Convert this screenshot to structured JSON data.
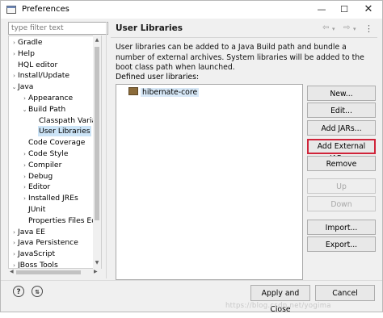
{
  "window": {
    "title": "Preferences"
  },
  "filter": {
    "placeholder": "type filter text"
  },
  "tree": [
    {
      "label": "Gradle",
      "arrow": "›",
      "level": 0
    },
    {
      "label": "Help",
      "arrow": "›",
      "level": 0
    },
    {
      "label": "HQL editor",
      "arrow": "",
      "level": 0
    },
    {
      "label": "Install/Update",
      "arrow": "›",
      "level": 0
    },
    {
      "label": "Java",
      "arrow": "⌄",
      "level": 0
    },
    {
      "label": "Appearance",
      "arrow": "›",
      "level": 1
    },
    {
      "label": "Build Path",
      "arrow": "⌄",
      "level": 1
    },
    {
      "label": "Classpath Varia",
      "arrow": "",
      "level": 2
    },
    {
      "label": "User Libraries",
      "arrow": "",
      "level": 2,
      "selected": true
    },
    {
      "label": "Code Coverage",
      "arrow": "",
      "level": 1
    },
    {
      "label": "Code Style",
      "arrow": "›",
      "level": 1
    },
    {
      "label": "Compiler",
      "arrow": "›",
      "level": 1
    },
    {
      "label": "Debug",
      "arrow": "›",
      "level": 1
    },
    {
      "label": "Editor",
      "arrow": "›",
      "level": 1
    },
    {
      "label": "Installed JREs",
      "arrow": "›",
      "level": 1
    },
    {
      "label": "JUnit",
      "arrow": "",
      "level": 1
    },
    {
      "label": "Properties Files Ed",
      "arrow": "",
      "level": 1
    },
    {
      "label": "Java EE",
      "arrow": "›",
      "level": 0
    },
    {
      "label": "Java Persistence",
      "arrow": "›",
      "level": 0
    },
    {
      "label": "JavaScript",
      "arrow": "›",
      "level": 0
    },
    {
      "label": "JBoss Tools",
      "arrow": "›",
      "level": 0
    }
  ],
  "panel": {
    "title": "User Libraries",
    "description": "User libraries can be added to a Java Build path and bundle a number of external archives. System libraries will be added to the boot class path when launched.",
    "defined_label": "Defined user libraries:",
    "libraries": [
      "hibernate-core"
    ]
  },
  "buttons": {
    "new": "New...",
    "edit": "Edit...",
    "add_jars": "Add JARs...",
    "add_external_jars": "Add External JARs...",
    "remove": "Remove",
    "up": "Up",
    "down": "Down",
    "import": "Import...",
    "export": "Export..."
  },
  "footer": {
    "apply_close": "Apply and Close",
    "cancel": "Cancel"
  },
  "watermark": "https://blog.csdn.net/yogima",
  "colors": {
    "highlight_border": "#d0243a",
    "selection": "#cce4f7"
  }
}
